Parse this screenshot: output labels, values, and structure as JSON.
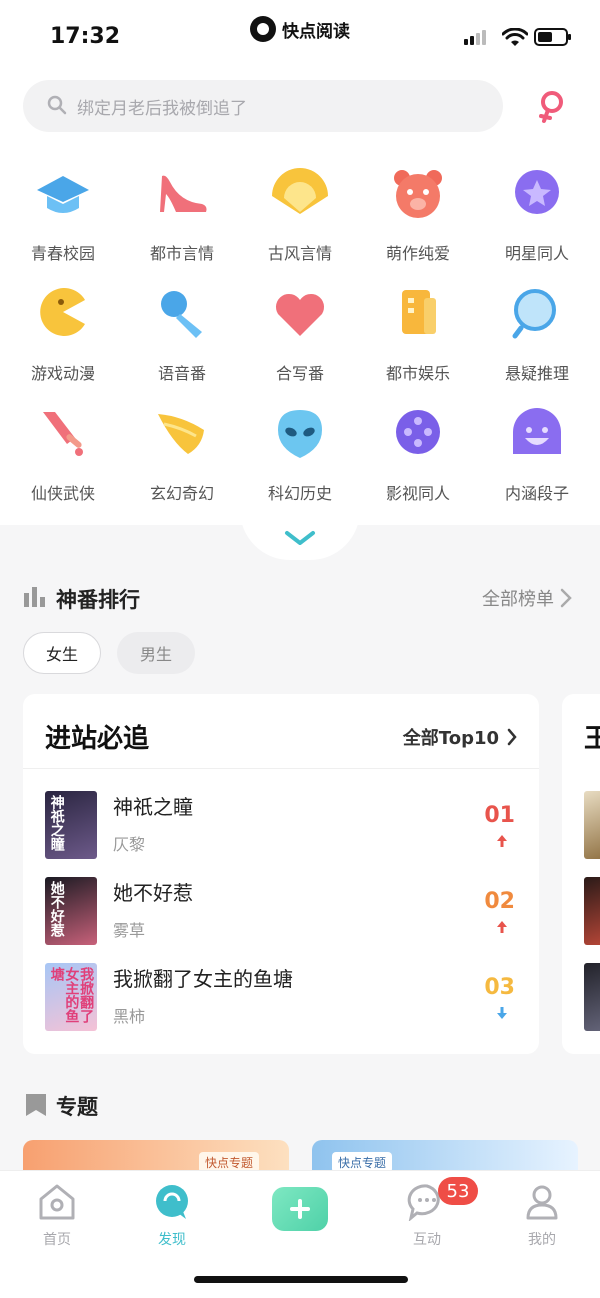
{
  "status_bar": {
    "time": "17:32",
    "app_name": "快点阅读"
  },
  "search": {
    "placeholder": "绑定月老后我被倒追了"
  },
  "categories": [
    {
      "label": "青春校园",
      "icon": "graduation-cap-icon"
    },
    {
      "label": "都市言情",
      "icon": "high-heel-icon"
    },
    {
      "label": "古风言情",
      "icon": "folding-fan-icon"
    },
    {
      "label": "萌作纯爱",
      "icon": "bear-icon"
    },
    {
      "label": "明星同人",
      "icon": "star-icon"
    },
    {
      "label": "游戏动漫",
      "icon": "pacman-icon"
    },
    {
      "label": "语音番",
      "icon": "microphone-icon"
    },
    {
      "label": "合写番",
      "icon": "heart-icon"
    },
    {
      "label": "都市娱乐",
      "icon": "building-icon"
    },
    {
      "label": "悬疑推理",
      "icon": "magnifier-icon"
    },
    {
      "label": "仙侠武侠",
      "icon": "sword-icon"
    },
    {
      "label": "玄幻奇幻",
      "icon": "wing-icon"
    },
    {
      "label": "科幻历史",
      "icon": "alien-icon"
    },
    {
      "label": "影视同人",
      "icon": "film-reel-icon"
    },
    {
      "label": "内涵段子",
      "icon": "smiling-face-icon"
    }
  ],
  "ranking": {
    "title": "神番排行",
    "all_link": "全部榜单",
    "filters": [
      "女生",
      "男生"
    ],
    "card": {
      "title": "进站必追",
      "more": "全部Top10",
      "books": [
        {
          "title": "神祇之瞳",
          "author": "仄黎",
          "rank": "01",
          "trend": "up",
          "cover_text": "神祇之瞳"
        },
        {
          "title": "她不好惹",
          "author": "雾草",
          "rank": "02",
          "trend": "up",
          "cover_text": "她不好惹"
        },
        {
          "title": "我掀翻了女主的鱼塘",
          "author": "黑柿",
          "rank": "03",
          "trend": "down",
          "cover_text": "我掀翻了女主的鱼塘"
        }
      ]
    },
    "next_card_peek": "王"
  },
  "topics": {
    "title": "专题",
    "banner_left": "快点专题",
    "banner_right": "快点专题"
  },
  "tabbar": {
    "items": [
      {
        "label": "首页",
        "icon": "home-icon"
      },
      {
        "label": "发现",
        "icon": "discover-icon"
      },
      {
        "label": "",
        "icon": "plus-icon"
      },
      {
        "label": "互动",
        "icon": "chat-bubble-icon"
      },
      {
        "label": "我的",
        "icon": "profile-icon"
      }
    ],
    "badge": "53"
  },
  "colors": {
    "accent": "#3fbecb",
    "rank1": "#e8544c",
    "rank2": "#f08a3e",
    "rank3": "#f5b940"
  }
}
